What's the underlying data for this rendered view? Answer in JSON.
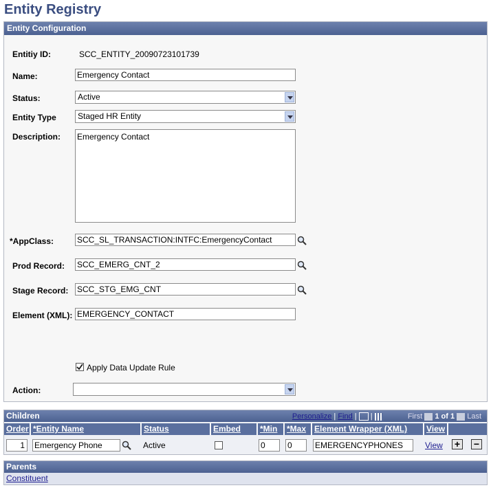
{
  "page": {
    "title": "Entity Registry"
  },
  "config": {
    "header": "Entity Configuration",
    "entity_id_label": "Entitiy ID:",
    "entity_id_value": "SCC_ENTITY_20090723101739",
    "name_label": "Name:",
    "name_value": "Emergency Contact",
    "status_label": "Status:",
    "status_value": "Active",
    "entity_type_label": "Entity Type",
    "entity_type_value": "Staged HR Entity",
    "description_label": "Description:",
    "description_value": "Emergency Contact",
    "appclass_label": "*AppClass:",
    "appclass_value": "SCC_SL_TRANSACTION:INTFC:EmergencyContact",
    "prod_record_label": "Prod Record:",
    "prod_record_value": "SCC_EMERG_CNT_2",
    "stage_record_label": "Stage Record:",
    "stage_record_value": "SCC_STG_EMG_CNT",
    "element_label": "Element (XML):",
    "element_value": "EMERGENCY_CONTACT",
    "apply_rule_label": "Apply Data Update Rule",
    "apply_rule_checked": true,
    "action_label": "Action:",
    "action_value": ""
  },
  "children": {
    "title": "Children",
    "personalize": "Personalize",
    "find": "Find",
    "first": "First",
    "range": "1 of 1",
    "last": "Last",
    "columns": [
      "Order",
      "*Entity Name",
      "Status",
      "Embed",
      "*Min",
      "*Max",
      "Element Wrapper (XML)",
      "View"
    ],
    "row": {
      "order": "1",
      "entity_name": "Emergency Phone",
      "status": "Active",
      "min": "0",
      "max": "0",
      "wrapper": "EMERGENCYPHONES",
      "view": "View"
    }
  },
  "parents": {
    "title": "Parents",
    "item": "Constituent"
  }
}
